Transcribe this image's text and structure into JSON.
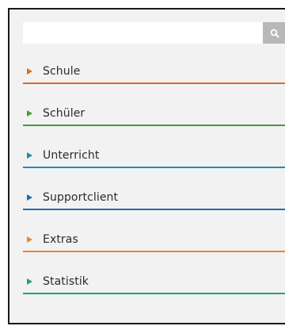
{
  "search": {
    "value": "",
    "placeholder": ""
  },
  "menu": {
    "items": [
      {
        "label": "Schule",
        "color": "#e06a21"
      },
      {
        "label": "Schüler",
        "color": "#4a9a3a"
      },
      {
        "label": "Unterricht",
        "color": "#1a8fb5"
      },
      {
        "label": "Supportclient",
        "color": "#1f6fb0"
      },
      {
        "label": "Extras",
        "color": "#e8882e"
      },
      {
        "label": "Statistik",
        "color": "#1fa088"
      }
    ]
  },
  "icons": {
    "search": "search-icon",
    "item_arrow": "triangle-right-icon"
  }
}
